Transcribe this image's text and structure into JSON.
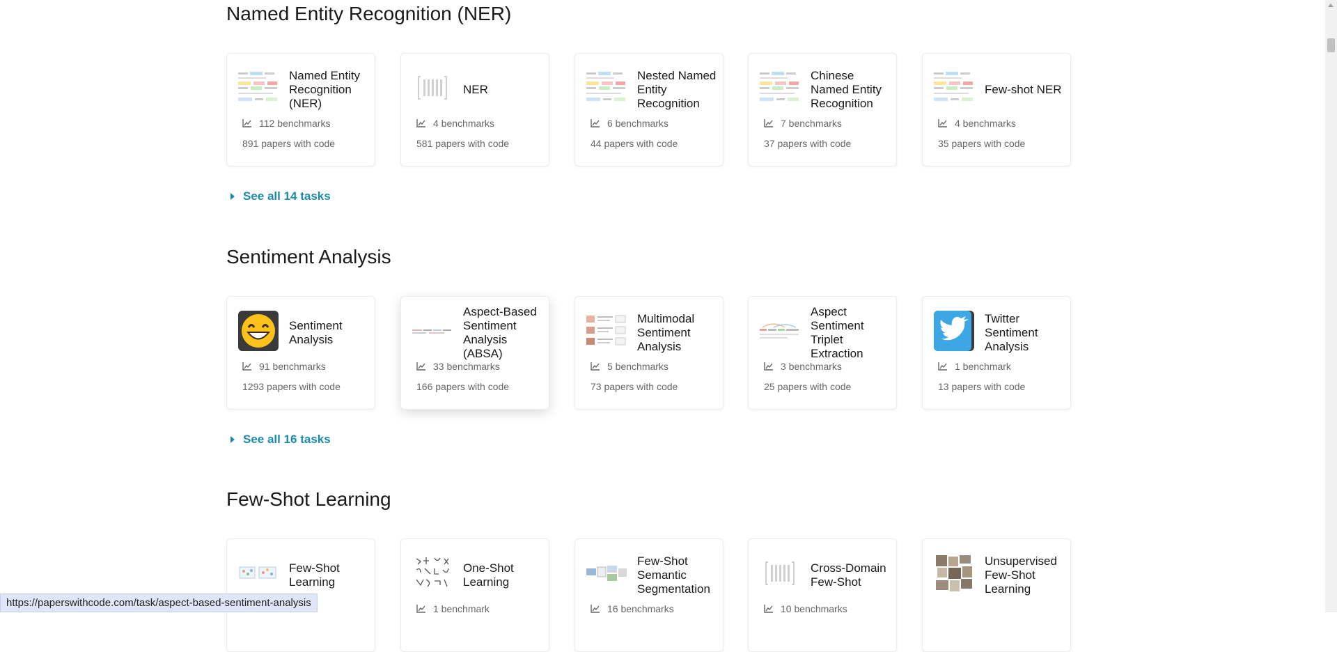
{
  "sections": [
    {
      "title": "Named Entity Recognition (NER)",
      "see_all": "See all 14 tasks",
      "cards": [
        {
          "title": "Named Entity Recognition (NER)",
          "benchmarks": "112 benchmarks",
          "papers": "891 papers with code",
          "thumb": "ner-annotation-image"
        },
        {
          "title": "NER",
          "benchmarks": "4 benchmarks",
          "papers": "581 papers with code",
          "thumb": "placeholder-barcode-icon"
        },
        {
          "title": "Nested Named Entity Recognition",
          "benchmarks": "6 benchmarks",
          "papers": "44 papers with code",
          "thumb": "ner-annotation-image"
        },
        {
          "title": "Chinese Named Entity Recognition",
          "benchmarks": "7 benchmarks",
          "papers": "37 papers with code",
          "thumb": "ner-annotation-image"
        },
        {
          "title": "Few-shot NER",
          "benchmarks": "4 benchmarks",
          "papers": "35 papers with code",
          "thumb": "ner-annotation-image"
        }
      ]
    },
    {
      "title": "Sentiment Analysis",
      "see_all": "See all 16 tasks",
      "cards": [
        {
          "title": "Sentiment Analysis",
          "benchmarks": "91 benchmarks",
          "papers": "1293 papers with code",
          "thumb": "smiley-emoji-icon"
        },
        {
          "title": "Aspect-Based Sentiment Analysis (ABSA)",
          "benchmarks": "33 benchmarks",
          "papers": "166 papers with code",
          "thumb": "absa-diagram-image"
        },
        {
          "title": "Multimodal Sentiment Analysis",
          "benchmarks": "5 benchmarks",
          "papers": "73 papers with code",
          "thumb": "multimodal-diagram-image"
        },
        {
          "title": "Aspect Sentiment Triplet Extraction",
          "benchmarks": "3 benchmarks",
          "papers": "25 papers with code",
          "thumb": "triplet-diagram-image"
        },
        {
          "title": "Twitter Sentiment Analysis",
          "benchmarks": "1 benchmark",
          "papers": "13 papers with code",
          "thumb": "twitter-bird-icon"
        }
      ]
    },
    {
      "title": "Few-Shot Learning",
      "see_all": "",
      "cards": [
        {
          "title": "Few-Shot Learning",
          "benchmarks": "",
          "papers": "",
          "thumb": "few-shot-diagram-image"
        },
        {
          "title": "One-Shot Learning",
          "benchmarks": "1 benchmark",
          "papers": "",
          "thumb": "handwritten-characters-image"
        },
        {
          "title": "Few-Shot Semantic Segmentation",
          "benchmarks": "16 benchmarks",
          "papers": "",
          "thumb": "segmentation-diagram-image"
        },
        {
          "title": "Cross-Domain Few-Shot",
          "benchmarks": "10 benchmarks",
          "papers": "",
          "thumb": "placeholder-barcode-icon"
        },
        {
          "title": "Unsupervised Few-Shot Learning",
          "benchmarks": "",
          "papers": "",
          "thumb": "photo-collage-image"
        }
      ]
    }
  ],
  "status_bar": {
    "url": "https://paperswithcode.com/task/aspect-based-sentiment-analysis"
  },
  "colors": {
    "link": "#1c8aaa",
    "muted_text": "#666666",
    "status_bg": "#dfe6f7"
  }
}
